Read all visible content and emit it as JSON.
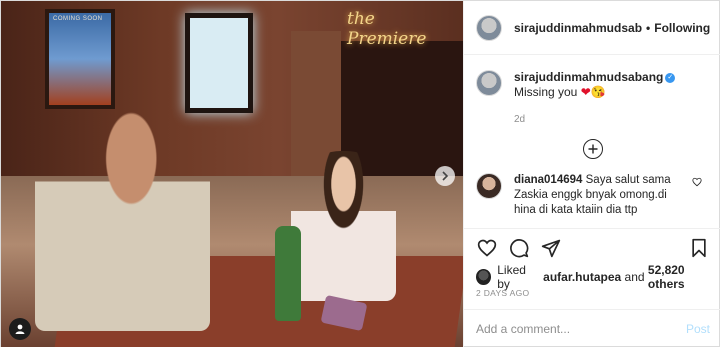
{
  "photo": {
    "poster_text": "COMING SOON",
    "venue_sign": "the Premiere",
    "next_icon": "chevron-right-icon",
    "tag_icon": "user-tag-icon"
  },
  "header": {
    "username": "sirajuddinmahmudsab",
    "separator": "•",
    "follow_label": "Following"
  },
  "caption": {
    "username": "sirajuddinmahmudsabang",
    "verified_icon": "verified-badge-icon",
    "text": "Missing you",
    "emoji_heart": "❤",
    "emoji_face": "😘",
    "time": "2d"
  },
  "load_more_icon": "plus-circle-icon",
  "comments": [
    {
      "username": "diana014694",
      "text": "Saya salut sama Zaskia enggk bnyak omong.di hina di kata ktaiin dia ttp"
    }
  ],
  "actions": {
    "like_icon": "heart-icon",
    "comment_icon": "comment-icon",
    "share_icon": "send-icon",
    "save_icon": "bookmark-icon"
  },
  "likes": {
    "prefix": "Liked by",
    "user": "aufar.hutapea",
    "and": "and",
    "count": "52,820 others"
  },
  "posted_time": "2 DAYS AGO",
  "add_comment": {
    "placeholder": "Add a comment...",
    "post_label": "Post"
  },
  "colors": {
    "verified": "#3897f0",
    "post_disabled": "#b2dffc",
    "muted": "#8e8e8e"
  }
}
